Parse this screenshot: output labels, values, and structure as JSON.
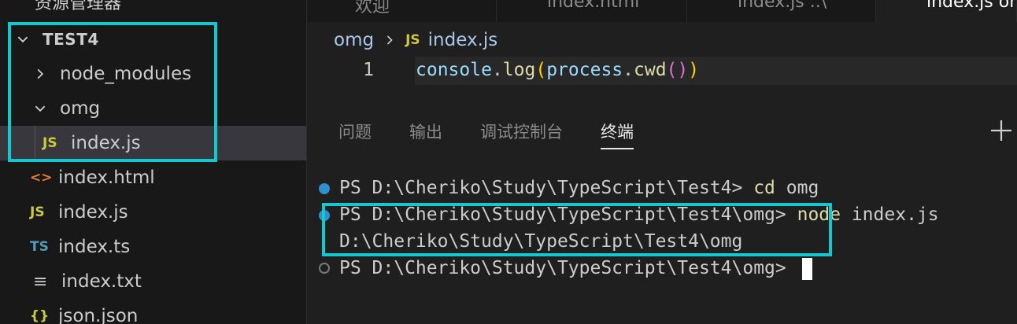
{
  "sidebar": {
    "title": "资源管理器",
    "root_folder": "TEST4",
    "items": [
      {
        "label": "node_modules",
        "icon": "chevron-right-icon"
      },
      {
        "label": "omg",
        "icon": "chevron-down-icon"
      },
      {
        "label": "index.js",
        "icon_text": "JS",
        "icon_color": "#cbcb41"
      },
      {
        "label": "index.html",
        "icon_text": "<>",
        "icon_color": "#e37933"
      },
      {
        "label": "index.js",
        "icon_text": "JS",
        "icon_color": "#cbcb41"
      },
      {
        "label": "index.ts",
        "icon_text": "TS",
        "icon_color": "#519aba"
      },
      {
        "label": "index.txt",
        "icon_text": "≡",
        "icon_color": "#cccccc"
      },
      {
        "label": "json.json",
        "icon_text": "{}",
        "icon_color": "#cbcb41"
      }
    ]
  },
  "tabs": [
    {
      "label": "欢迎"
    },
    {
      "label": "index.html"
    },
    {
      "label": "index.js ..\\"
    },
    {
      "label": "index.js  omg"
    }
  ],
  "breadcrumb": {
    "folder": "omg",
    "file_badge": "JS",
    "file": "index.js"
  },
  "editor": {
    "line_number": "1",
    "code": {
      "obj": "console",
      "dot1": ".",
      "fn1": "log",
      "p1_open": "(",
      "arg_obj": "process",
      "dot2": ".",
      "fn2": "cwd",
      "p2": "()",
      "p1_close": ")"
    }
  },
  "panel": {
    "tabs": [
      "问题",
      "输出",
      "调试控制台",
      "终端"
    ],
    "active_tab": "终端"
  },
  "terminal": {
    "lines": [
      {
        "prompt": "PS D:\\Cheriko\\Study\\TypeScript\\Test4> ",
        "cmd": "cd",
        "args": " omg"
      },
      {
        "prompt": "PS D:\\Cheriko\\Study\\TypeScript\\Test4\\omg> ",
        "cmd": "node",
        "args": " index.js"
      },
      {
        "output": "D:\\Cheriko\\Study\\TypeScript\\Test4\\omg"
      },
      {
        "prompt": "PS D:\\Cheriko\\Study\\TypeScript\\Test4\\omg> "
      }
    ]
  },
  "colors": {
    "highlight": "#14c8d0",
    "accent_blue": "#2f8fcf"
  }
}
